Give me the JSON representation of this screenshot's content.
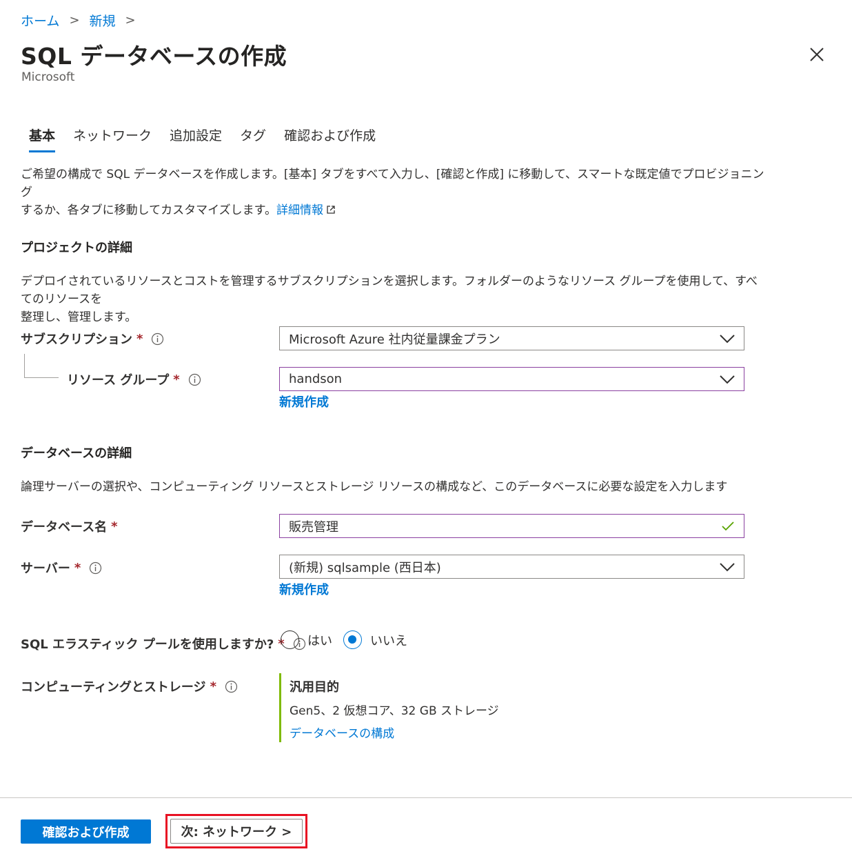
{
  "breadcrumb": {
    "home": "ホーム",
    "new": "新規",
    "sep": ">"
  },
  "title": "SQL データベースの作成",
  "publisher": "Microsoft",
  "tabs": [
    {
      "label": "基本"
    },
    {
      "label": "ネットワーク"
    },
    {
      "label": "追加設定"
    },
    {
      "label": "タグ"
    },
    {
      "label": "確認および作成"
    }
  ],
  "intro": {
    "line1": "ご希望の構成で SQL データベースを作成します。[基本] タブをすべて入力し、[確認と作成] に移動して、スマートな既定値でプロビジョニング",
    "line2": "するか、各タブに移動してカスタマイズします。",
    "link": "詳細情報"
  },
  "project": {
    "heading": "プロジェクトの詳細",
    "desc1": "デプロイされているリソースとコストを管理するサブスクリプションを選択します。フォルダーのようなリソース グループを使用して、すべてのリソースを",
    "desc2": "整理し、管理します。",
    "subscription_label": "サブスクリプション",
    "subscription_value": "Microsoft Azure 社内従量課金プラン",
    "rg_label": "リソース グループ",
    "rg_value": "handson",
    "rg_new": "新規作成"
  },
  "database": {
    "heading": "データベースの詳細",
    "desc": "論理サーバーの選択や、コンピューティング リソースとストレージ リソースの構成など、このデータベースに必要な設定を入力します",
    "name_label": "データベース名",
    "name_value": "販売管理",
    "server_label": "サーバー",
    "server_value": "(新規) sqlsample (西日本)",
    "server_new": "新規作成",
    "elastic_label": "SQL エラスティック プールを使用しますか?",
    "elastic_yes": "はい",
    "elastic_no": "いいえ",
    "compute_label": "コンピューティングとストレージ",
    "compute_tier": "汎用目的",
    "compute_spec": "Gen5、2 仮想コア、32 GB ストレージ",
    "compute_link": "データベースの構成"
  },
  "required_mark": "*",
  "footer": {
    "review_button": "確認および作成",
    "next_button": "次: ネットワーク >"
  },
  "colors": {
    "accent": "#0078d4",
    "required": "#a4262c",
    "valid": "#57a300",
    "compute_bar": "#7fba00",
    "highlight": "#e81123"
  }
}
